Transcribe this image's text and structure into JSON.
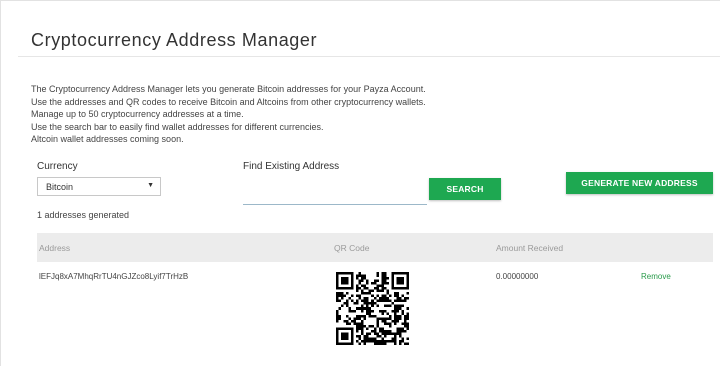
{
  "page": {
    "title": "Cryptocurrency Address Manager",
    "description": [
      "The Cryptocurrency Address Manager lets you generate Bitcoin addresses for your Payza Account.",
      "Use the addresses and QR codes to receive Bitcoin and Altcoins from other cryptocurrency wallets.",
      "Manage up to 50 cryptocurrency addresses at a time.",
      "Use the search bar to easily find wallet addresses for different currencies.",
      "Altcoin wallet addresses coming soon."
    ]
  },
  "controls": {
    "currency_label": "Currency",
    "currency_selected": "Bitcoin",
    "find_label": "Find Existing Address",
    "search_value": "",
    "search_button": "SEARCH",
    "generate_button": "GENERATE NEW ADDRESS"
  },
  "summary": {
    "count_text": "1 addresses generated"
  },
  "table": {
    "headers": {
      "address": "Address",
      "qr": "QR Code",
      "amount": "Amount Received"
    },
    "rows": [
      {
        "address": "lEFJq8xA7MhqRrTU4nGJZco8Lyif7TrHzB",
        "amount": "0.00000000",
        "action": "Remove"
      }
    ]
  },
  "colors": {
    "accent_green": "#1ea851",
    "link_green": "#2a9b4b",
    "header_bg": "#ececec"
  },
  "icons": {
    "select_caret": "caret-down-icon",
    "qr": "qr-code-icon"
  }
}
